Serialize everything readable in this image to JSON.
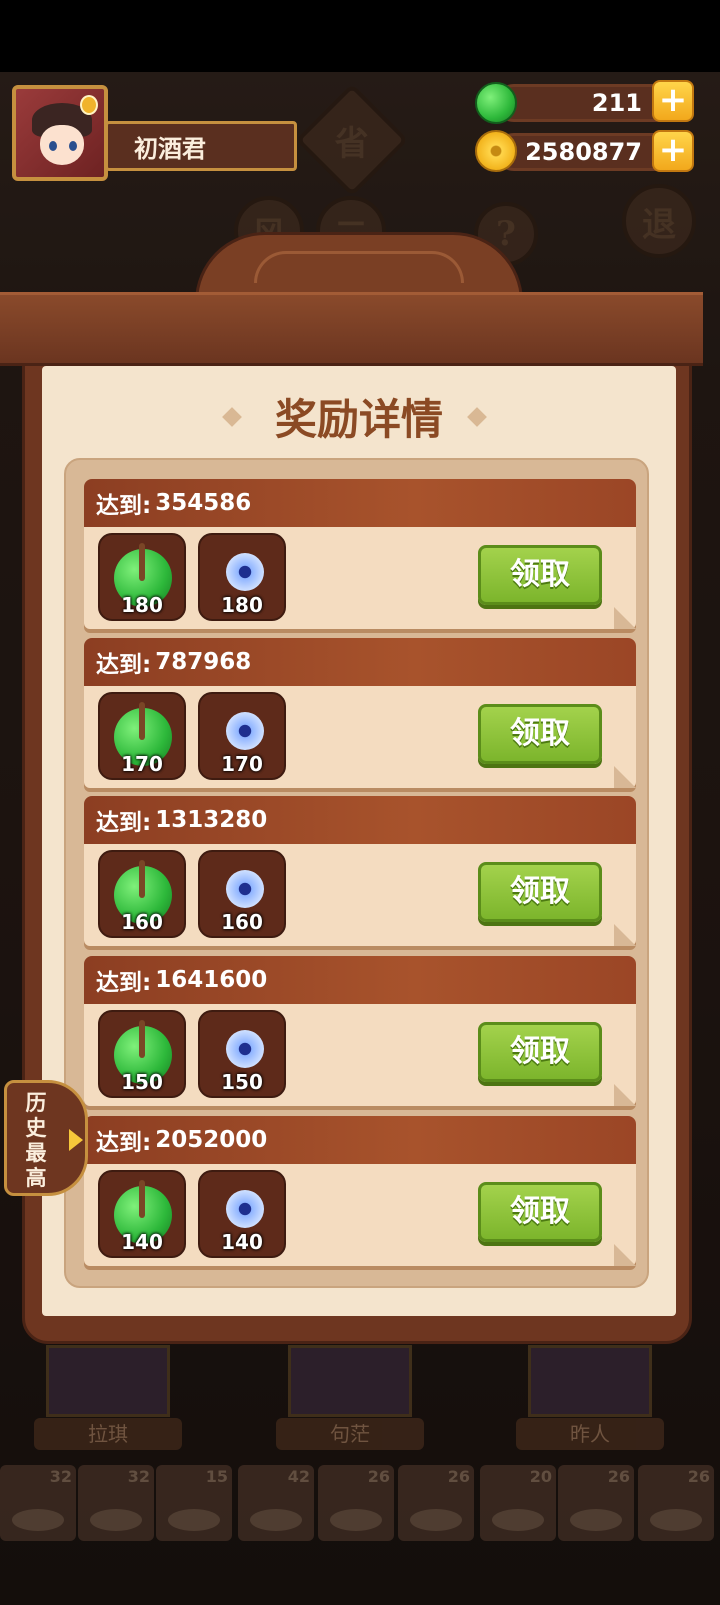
{
  "player": {
    "name": "初酒君"
  },
  "currency": {
    "jade": "211",
    "coins": "2580877",
    "plus": "+"
  },
  "background": {
    "disc_sheng": "省",
    "disc_feng": "风",
    "disc_er": "二",
    "disc_tui": "退",
    "disc_help": "?"
  },
  "panel": {
    "title": "奖励详情",
    "claim_label": "领取",
    "reach_label": "达到:",
    "rewards": [
      {
        "target": "354586",
        "jade": "180",
        "disc": "180"
      },
      {
        "target": "787968",
        "jade": "170",
        "disc": "170"
      },
      {
        "target": "1313280",
        "jade": "160",
        "disc": "160"
      },
      {
        "target": "1641600",
        "jade": "150",
        "disc": "150"
      },
      {
        "target": "2052000",
        "jade": "140",
        "disc": "140"
      }
    ]
  },
  "history_tab": {
    "label": "历史最高"
  },
  "characters": [
    "拉琪",
    "句茫",
    "昨人"
  ],
  "dishes": [
    "32",
    "32",
    "15",
    "42",
    "26",
    "26",
    "20",
    "26",
    "26"
  ],
  "icons": {
    "jade": "jade-coin-icon",
    "coin": "gold-coin-icon",
    "disc": "blue-disc-icon",
    "arrow": "arrow-right-icon"
  },
  "colors": {
    "panel_wood": "#6e3620",
    "paper": "#f4e4cd",
    "claim_green": "#8cc43a",
    "header_red": "#9b4626"
  }
}
